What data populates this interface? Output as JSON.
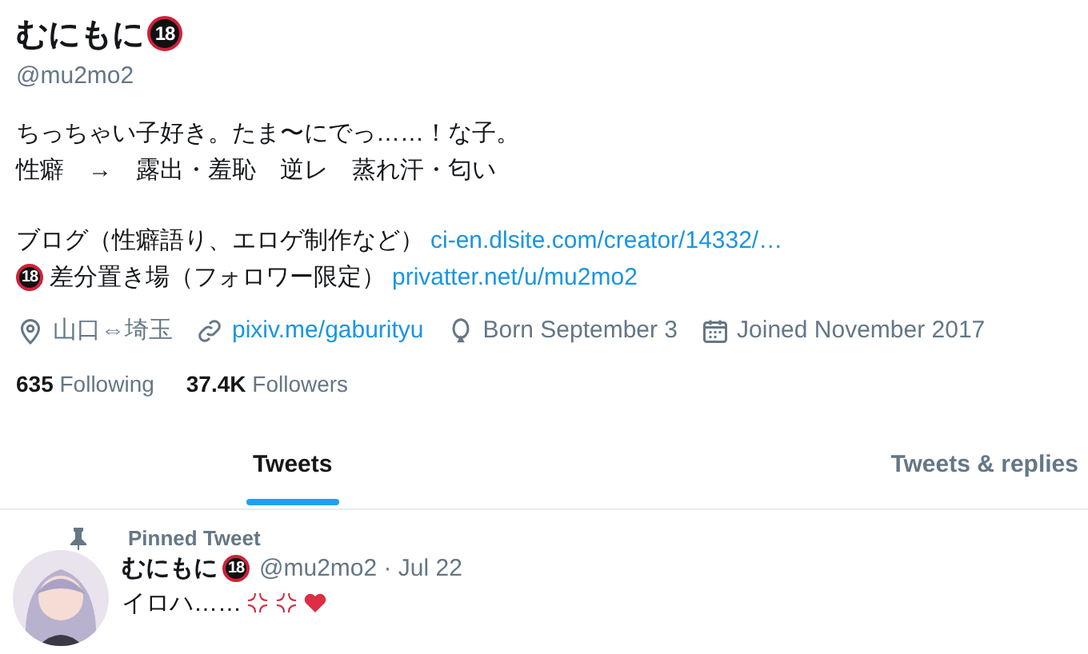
{
  "profile": {
    "name": "むにもに",
    "name_badge": "18",
    "handle": "@mu2mo2",
    "bio": [
      [
        [
          {
            "kind": "text",
            "text": "ちっちゃい子好き。たま〜にでっ……！な子。"
          }
        ],
        [
          {
            "kind": "text",
            "text": "性癖　→　露出・羞恥　逆レ　蒸れ汗・匂い"
          }
        ]
      ],
      [
        [
          {
            "kind": "text",
            "text": "ブログ（性癖語り、エロゲ制作など）"
          },
          {
            "kind": "link",
            "text": "ci-en.dlsite.com/creator/14332/…"
          }
        ],
        [
          {
            "kind": "badge",
            "text": "18"
          },
          {
            "kind": "text",
            "text": "差分置き場（フォロワー限定）"
          },
          {
            "kind": "link",
            "text": "privatter.net/u/mu2mo2"
          }
        ]
      ]
    ],
    "meta": [
      {
        "kind": "location",
        "text": "山口⇔埼玉"
      },
      {
        "kind": "link",
        "text": "pixiv.me/gaburityu"
      },
      {
        "kind": "birthday",
        "text": "Born September 3"
      },
      {
        "kind": "joined",
        "text": "Joined November 2017"
      }
    ],
    "stats": [
      {
        "count": "635",
        "label": "Following"
      },
      {
        "count": "37.4K",
        "label": "Followers"
      }
    ]
  },
  "tabs": [
    {
      "label": "Tweets",
      "selected": true
    },
    {
      "label": "Tweets & replies",
      "selected": false
    }
  ],
  "pinned_tweet": {
    "label": "Pinned Tweet",
    "author": "むにもに",
    "author_badge": "18",
    "meta": "@mu2mo2 · Jul 22",
    "text": "イロハ……",
    "emoji": [
      {
        "kind": "anger"
      },
      {
        "kind": "anger"
      },
      {
        "kind": "heart"
      }
    ]
  }
}
